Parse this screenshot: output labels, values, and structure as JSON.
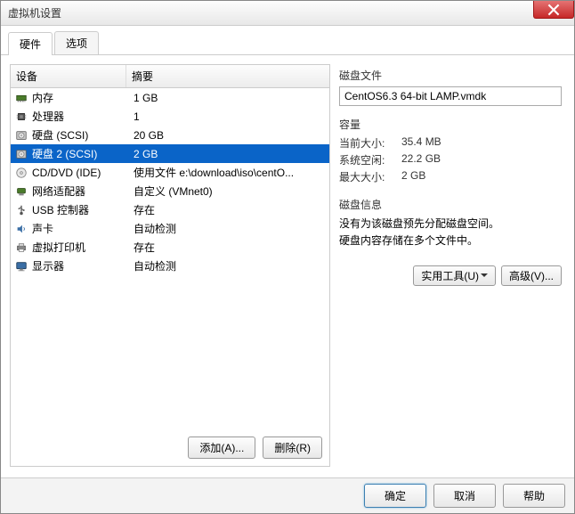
{
  "window": {
    "title": "虚拟机设置"
  },
  "tabs": [
    {
      "label": "硬件",
      "active": true
    },
    {
      "label": "选项",
      "active": false
    }
  ],
  "table": {
    "headers": {
      "device": "设备",
      "summary": "摘要"
    },
    "rows": [
      {
        "icon": "memory",
        "device": "内存",
        "summary": "1 GB",
        "selected": false
      },
      {
        "icon": "cpu",
        "device": "处理器",
        "summary": "1",
        "selected": false
      },
      {
        "icon": "disk",
        "device": "硬盘 (SCSI)",
        "summary": "20 GB",
        "selected": false
      },
      {
        "icon": "disk",
        "device": "硬盘 2 (SCSI)",
        "summary": "2 GB",
        "selected": true
      },
      {
        "icon": "cd",
        "device": "CD/DVD (IDE)",
        "summary": "使用文件 e:\\download\\iso\\centO...",
        "selected": false
      },
      {
        "icon": "network",
        "device": "网络适配器",
        "summary": "自定义 (VMnet0)",
        "selected": false
      },
      {
        "icon": "usb",
        "device": "USB 控制器",
        "summary": "存在",
        "selected": false
      },
      {
        "icon": "sound",
        "device": "声卡",
        "summary": "自动检测",
        "selected": false
      },
      {
        "icon": "printer",
        "device": "虚拟打印机",
        "summary": "存在",
        "selected": false
      },
      {
        "icon": "display",
        "device": "显示器",
        "summary": "自动检测",
        "selected": false
      }
    ]
  },
  "buttons": {
    "add": "添加(A)...",
    "remove": "删除(R)",
    "ok": "确定",
    "cancel": "取消",
    "help": "帮助",
    "utilities": "实用工具(U)",
    "advanced": "高级(V)..."
  },
  "right": {
    "diskFile": {
      "label": "磁盘文件",
      "value": "CentOS6.3 64-bit LAMP.vmdk"
    },
    "capacity": {
      "label": "容量",
      "current": {
        "label": "当前大小:",
        "value": "35.4 MB"
      },
      "free": {
        "label": "系统空闲:",
        "value": "22.2 GB"
      },
      "max": {
        "label": "最大大小:",
        "value": "2 GB"
      }
    },
    "diskInfo": {
      "label": "磁盘信息",
      "line1": "没有为该磁盘预先分配磁盘空间。",
      "line2": "硬盘内容存储在多个文件中。"
    }
  }
}
